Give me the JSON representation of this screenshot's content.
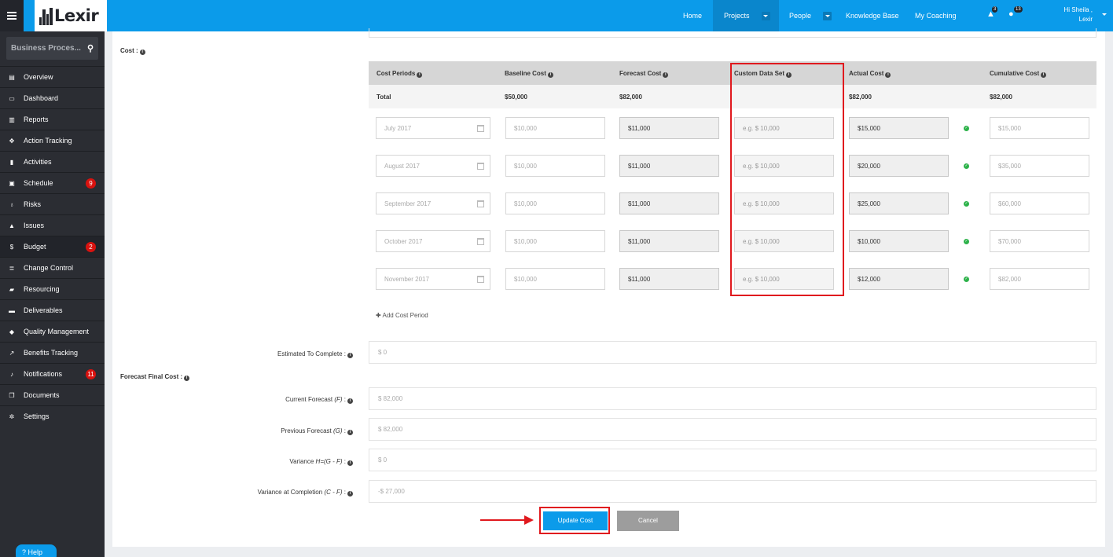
{
  "brand": {
    "logo_text": "Lexir"
  },
  "topnav": {
    "items": [
      {
        "label": "Home"
      },
      {
        "label": "Projects"
      },
      {
        "label": "People"
      },
      {
        "label": "Knowledge Base"
      },
      {
        "label": "My Coaching"
      }
    ],
    "alerts_count": "3",
    "updates_count": "13",
    "greeting_line1": "Hi Sheila ,",
    "greeting_line2": "Lexir"
  },
  "sidebar": {
    "search_placeholder": "Business Proces...",
    "items": [
      {
        "label": "Overview",
        "icon": "grid-icon",
        "glyph": "▤"
      },
      {
        "label": "Dashboard",
        "icon": "dashboard-icon",
        "glyph": "▭"
      },
      {
        "label": "Reports",
        "icon": "bar-chart-icon",
        "glyph": "▥"
      },
      {
        "label": "Action Tracking",
        "icon": "crosshair-icon",
        "glyph": "✥"
      },
      {
        "label": "Activities",
        "icon": "bookmark-icon",
        "glyph": "▮"
      },
      {
        "label": "Schedule",
        "icon": "calendar-icon",
        "glyph": "▣",
        "badge": "9"
      },
      {
        "label": "Risks",
        "icon": "bulb-icon",
        "glyph": "♁"
      },
      {
        "label": "Issues",
        "icon": "warning-icon",
        "glyph": "▲"
      },
      {
        "label": "Budget",
        "icon": "dollar-icon",
        "glyph": "$",
        "badge": "2",
        "active": true
      },
      {
        "label": "Change Control",
        "icon": "list-icon",
        "glyph": "≣"
      },
      {
        "label": "Resourcing",
        "icon": "folder-icon",
        "glyph": "▰"
      },
      {
        "label": "Deliverables",
        "icon": "truck-icon",
        "glyph": "▬"
      },
      {
        "label": "Quality Management",
        "icon": "tag-icon",
        "glyph": "◆"
      },
      {
        "label": "Benefits Tracking",
        "icon": "line-chart-icon",
        "glyph": "↗"
      },
      {
        "label": "Notifications",
        "icon": "bell-icon",
        "glyph": "♪",
        "badge": "11"
      },
      {
        "label": "Documents",
        "icon": "documents-icon",
        "glyph": "❐"
      },
      {
        "label": "Settings",
        "icon": "cogs-icon",
        "glyph": "✲"
      }
    ],
    "help_label": "Help"
  },
  "cost": {
    "section_label": "Cost :",
    "columns": [
      "Cost Periods",
      "Baseline Cost",
      "Forecast Cost",
      "Custom Data Set",
      "Actual Cost",
      "Cumulative Cost"
    ],
    "total": {
      "label": "Total",
      "baseline": "$50,000",
      "forecast": "$82,000",
      "actual": "$82,000",
      "cumulative": "$82,000"
    },
    "rows": [
      {
        "period": "July 2017",
        "baseline": "$10,000",
        "forecast": "$11,000",
        "custom_placeholder": "e.g. $ 10,000",
        "actual": "$15,000",
        "cumulative": "$15,000"
      },
      {
        "period": "August 2017",
        "baseline": "$10,000",
        "forecast": "$11,000",
        "custom_placeholder": "e.g. $ 10,000",
        "actual": "$20,000",
        "cumulative": "$35,000"
      },
      {
        "period": "September 2017",
        "baseline": "$10,000",
        "forecast": "$11,000",
        "custom_placeholder": "e.g. $ 10,000",
        "actual": "$25,000",
        "cumulative": "$60,000"
      },
      {
        "period": "October 2017",
        "baseline": "$10,000",
        "forecast": "$11,000",
        "custom_placeholder": "e.g. $ 10,000",
        "actual": "$10,000",
        "cumulative": "$70,000"
      },
      {
        "period": "November 2017",
        "baseline": "$10,000",
        "forecast": "$11,000",
        "custom_placeholder": "e.g. $ 10,000",
        "actual": "$12,000",
        "cumulative": "$82,000"
      }
    ],
    "add_period_label": "Add Cost Period"
  },
  "summary": {
    "etc_label": "Estimated To Complete :",
    "etc_value": "$ 0",
    "ffc_label": "Forecast Final Cost :",
    "current_label_main": "Current Forecast ",
    "current_label_sub": "(F)",
    "current_value": "$ 82,000",
    "previous_label_main": "Previous Forecast ",
    "previous_label_sub": "(G)",
    "previous_value": "$ 82,000",
    "variance_label_main": "Variance ",
    "variance_label_sub": "H=(G - F)",
    "variance_value": "$ 0",
    "vac_label_main": "Variance at Completion ",
    "vac_label_sub": "(C - F)",
    "vac_value": "-$ 27,000"
  },
  "actions": {
    "update_label": "Update Cost",
    "cancel_label": "Cancel"
  },
  "colors": {
    "brand_blue": "#0b9bea",
    "sidebar_bg": "#2b2d33",
    "highlight_red": "#e0191e",
    "badge_red": "#d8120f",
    "check_green": "#2db24a"
  }
}
